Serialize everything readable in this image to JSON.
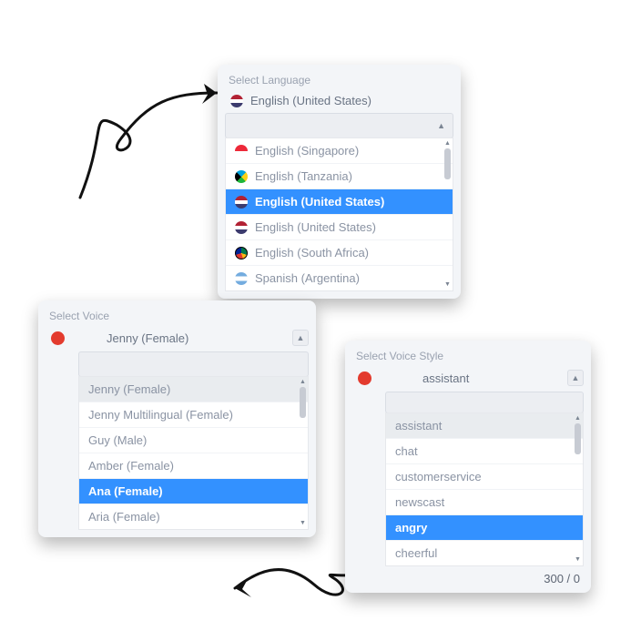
{
  "arrows": {
    "color": "#111111"
  },
  "language_panel": {
    "title": "Select Language",
    "selected_label": "English (United States)",
    "items": [
      {
        "flag": "sg",
        "label": "English (Singapore)"
      },
      {
        "flag": "tz",
        "label": "English (Tanzania)"
      },
      {
        "flag": "us",
        "label": "English (United States)",
        "selected": true
      },
      {
        "flag": "us",
        "label": "English (United States)"
      },
      {
        "flag": "za",
        "label": "English (South Africa)"
      },
      {
        "flag": "ar",
        "label": "Spanish (Argentina)"
      }
    ]
  },
  "voice_panel": {
    "title": "Select Voice",
    "selected_label": "Jenny (Female)",
    "items": [
      {
        "label": "Jenny (Female)",
        "highlighted": true
      },
      {
        "label": "Jenny Multilingual (Female)"
      },
      {
        "label": "Guy (Male)"
      },
      {
        "label": "Amber (Female)"
      },
      {
        "label": "Ana (Female)",
        "selected": true
      },
      {
        "label": "Aria (Female)"
      }
    ]
  },
  "style_panel": {
    "title": "Select Voice Style",
    "selected_label": "assistant",
    "items": [
      {
        "label": "assistant",
        "highlighted": true
      },
      {
        "label": "chat"
      },
      {
        "label": "customerservice"
      },
      {
        "label": "newscast"
      },
      {
        "label": "angry",
        "selected": true
      },
      {
        "label": "cheerful"
      }
    ],
    "counter": "300 / 0"
  }
}
